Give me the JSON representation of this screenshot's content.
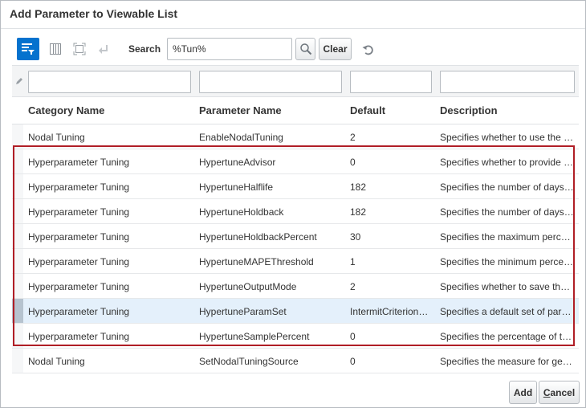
{
  "dialog": {
    "title": "Add Parameter to Viewable List"
  },
  "toolbar": {
    "search_label": "Search",
    "search_value": "%Tun%",
    "clear_label": "Clear"
  },
  "table": {
    "headers": [
      "Category Name",
      "Parameter Name",
      "Default",
      "Description"
    ],
    "rows": [
      [
        "Nodal Tuning",
        "EnableNodalTuning",
        "2",
        "Specifies whether to use the nodal tuning…"
      ],
      [
        "Hyperparameter Tuning",
        "HypertuneAdvisor",
        "0",
        "Specifies whether to provide advisor…"
      ],
      [
        "Hyperparameter Tuning",
        "HypertuneHalflife",
        "182",
        "Specifies the number of days…"
      ],
      [
        "Hyperparameter Tuning",
        "HypertuneHoldback",
        "182",
        "Specifies the number of days…"
      ],
      [
        "Hyperparameter Tuning",
        "HypertuneHoldbackPercent",
        "30",
        "Specifies the maximum percentage…"
      ],
      [
        "Hyperparameter Tuning",
        "HypertuneMAPEThreshold",
        "1",
        "Specifies the minimum percentage…"
      ],
      [
        "Hyperparameter Tuning",
        "HypertuneOutputMode",
        "2",
        "Specifies whether to save the results…"
      ],
      [
        "Hyperparameter Tuning",
        "HypertuneParamSet",
        "IntermitCriterion…",
        "Specifies a default set of parameters…"
      ],
      [
        "Hyperparameter Tuning",
        "HypertuneSamplePercent",
        "0",
        "Specifies the percentage of the data…"
      ],
      [
        "Nodal Tuning",
        "SetNodalTuningSource",
        "0",
        "Specifies the measure for generating…"
      ]
    ],
    "selected_row_index": 7
  },
  "footer": {
    "add_label": "Add",
    "cancel_first": "C",
    "cancel_rest": "ancel"
  },
  "colors": {
    "accent": "#0572ce",
    "highlight": "#b01e26",
    "selected_row": "#e4f0fb"
  }
}
